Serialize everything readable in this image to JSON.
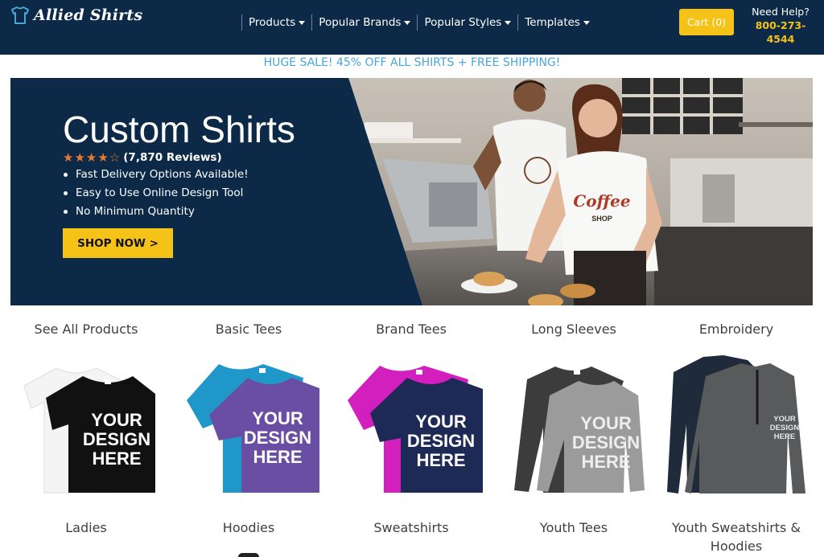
{
  "header": {
    "logo_text": "Allied Shirts",
    "nav": [
      {
        "label": "Products"
      },
      {
        "label": "Popular Brands"
      },
      {
        "label": "Popular Styles"
      },
      {
        "label": "Templates"
      }
    ],
    "cart_label": "Cart (0)",
    "help_label": "Need Help?",
    "phone": "800-273-4544",
    "bg_color": "#0c2a47",
    "accent_color": "#f5c318"
  },
  "sale_banner": "HUGE SALE! 45% OFF ALL SHIRTS + FREE SHIPPING!",
  "hero": {
    "title": "Custom Shirts",
    "stars": "★★★★☆",
    "rating_value": 4.5,
    "reviews": "(7,870 Reviews)",
    "features": [
      "Fast Delivery Options Available!",
      "Easy to Use Online Design Tool",
      "No Minimum Quantity"
    ],
    "cta": "SHOP NOW >",
    "shirt_print": {
      "top": "Coffee",
      "bottom": "SHOP"
    }
  },
  "shirt_print_text": [
    "YOUR",
    "DESIGN",
    "HERE"
  ],
  "categories_row1": [
    {
      "label": "See All Products"
    },
    {
      "label": "Basic Tees"
    },
    {
      "label": "Brand Tees"
    },
    {
      "label": "Long Sleeves"
    },
    {
      "label": "Embroidery"
    }
  ],
  "categories_row2": [
    {
      "label": "Ladies"
    },
    {
      "label": "Hoodies"
    },
    {
      "label": "Sweatshirts"
    },
    {
      "label": "Youth Tees"
    },
    {
      "label": "Youth Sweatshirts & Hoodies"
    }
  ]
}
